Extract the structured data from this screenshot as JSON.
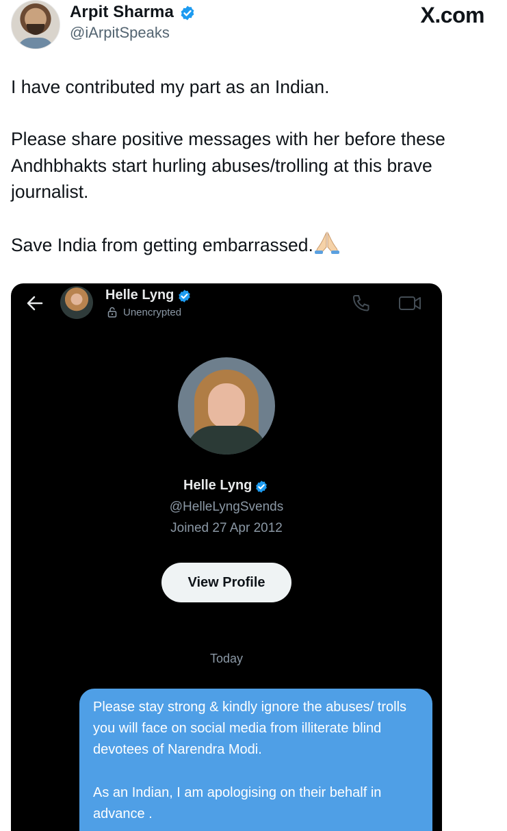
{
  "header": {
    "author_name": "Arpit Sharma",
    "author_handle": "@iArpitSpeaks",
    "site_logo": "X.com"
  },
  "tweet": {
    "line1": "I have contributed my part as an Indian.",
    "line2": "Please share positive messages with her before these Andhbhakts start hurling abuses/trolling at this brave journalist.",
    "line3": "Save India from getting embarrassed."
  },
  "dm": {
    "contact_name": "Helle Lyng",
    "encryption_status": "Unencrypted",
    "profile_name": "Helle Lyng",
    "profile_handle": "@HelleLyngSvends",
    "joined": "Joined 27 Apr 2012",
    "view_profile_label": "View Profile",
    "date_separator": "Today",
    "message_para1": "Please stay strong & kindly ignore the abuses/ trolls you will face on social media from illiterate blind devotees of Narendra Modi.",
    "message_para2": "As an Indian, I am apologising on their behalf in advance ."
  },
  "colors": {
    "verified": "#1d9bf0",
    "dm_background": "#000000",
    "bubble": "#4f9fe6",
    "secondary_text": "#536471"
  },
  "icons": [
    "verified-badge-icon",
    "pray-emoji-icon",
    "back-arrow-icon",
    "lock-icon",
    "phone-icon",
    "video-call-icon"
  ]
}
